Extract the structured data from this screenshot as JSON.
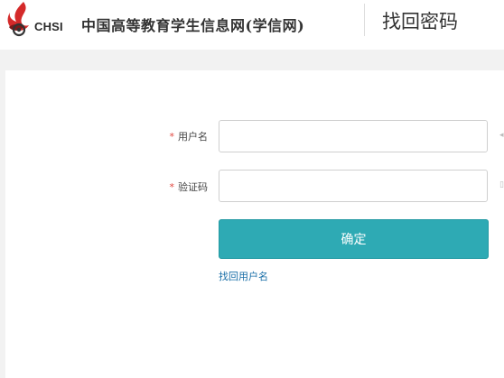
{
  "header": {
    "logo_text": "CHSI",
    "site_name": "中国高等教育学生信息网(学信网)",
    "page_title": "找回密码"
  },
  "form": {
    "username": {
      "required_mark": "*",
      "label": "用户名",
      "value": ""
    },
    "captcha": {
      "required_mark": "*",
      "label": "验证码",
      "value": ""
    },
    "submit_label": "确定",
    "recover_username_link": "找回用户名"
  },
  "colors": {
    "accent": "#2eaab4",
    "required": "#e0463f",
    "link": "#1a6fa8",
    "logo_red": "#d42a2a"
  }
}
